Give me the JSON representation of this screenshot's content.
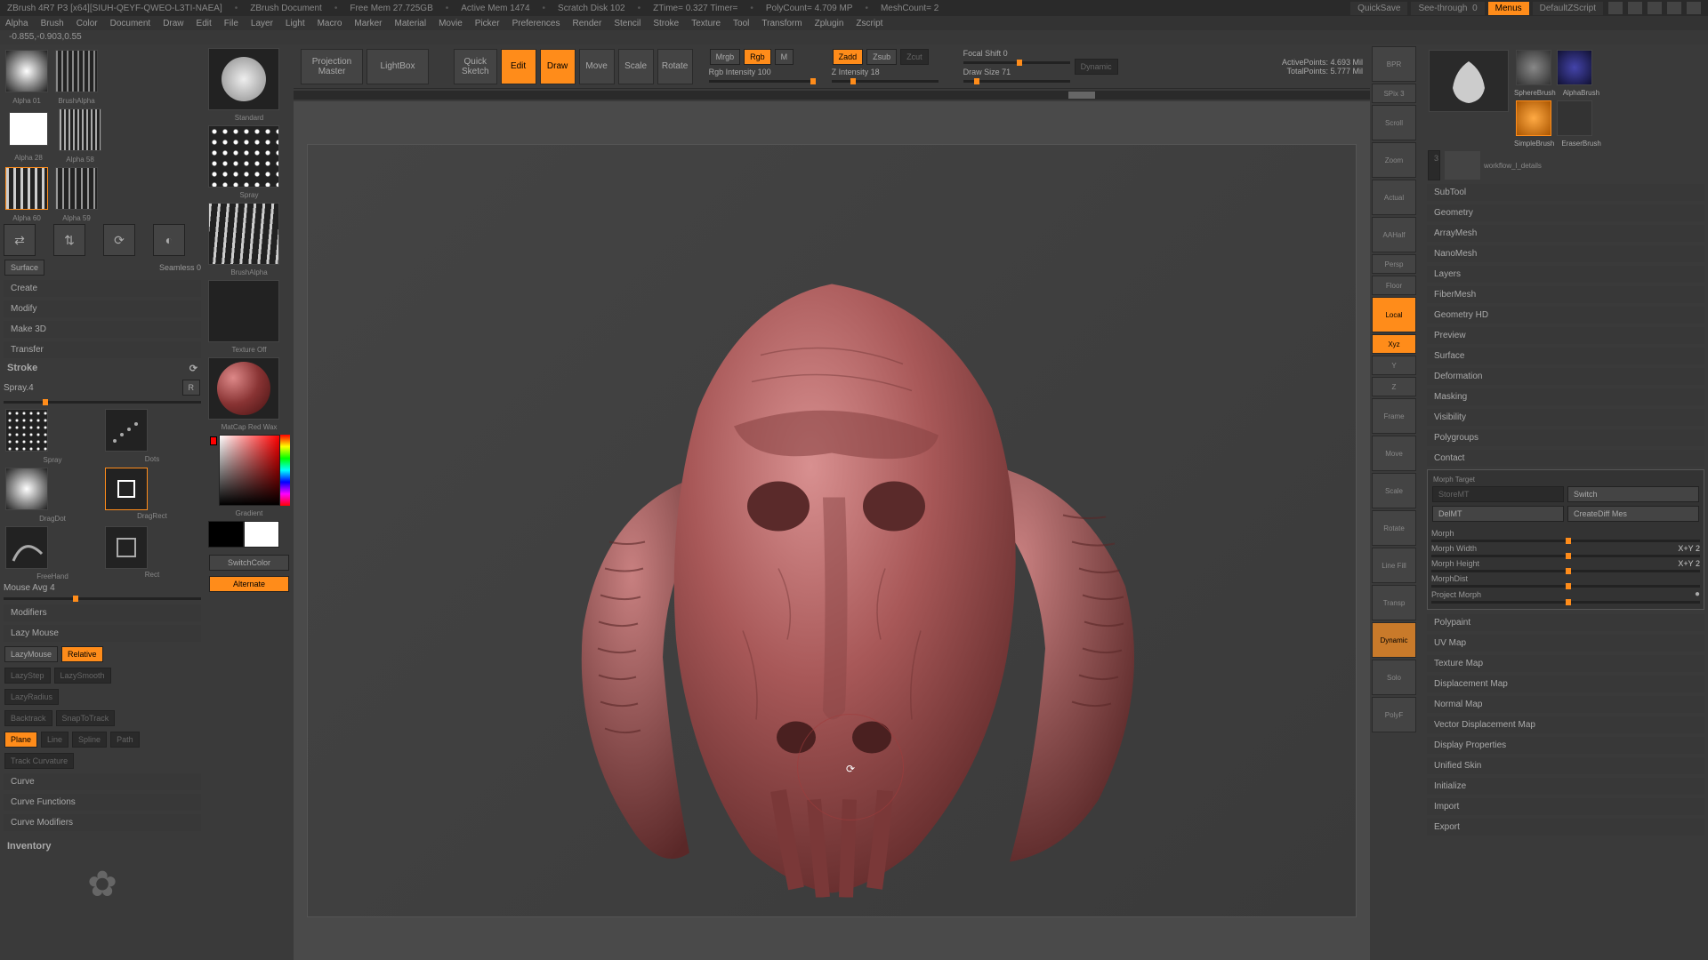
{
  "titlebar": {
    "app": "ZBrush 4R7 P3 [x64][SIUH-QEYF-QWEO-L3TI-NAEA]",
    "doc": "ZBrush Document",
    "freemem": "Free Mem 27.725GB",
    "activemem": "Active Mem 1474",
    "scratch": "Scratch Disk 102",
    "ztime": "ZTime= 0.327 Timer=",
    "polycount": "PolyCount= 4.709 MP",
    "meshcount": "MeshCount= 2",
    "quicksave": "QuickSave",
    "seethrough": "See-through",
    "seethroughval": "0",
    "menus": "Menus",
    "defaultscript": "DefaultZScript"
  },
  "menubar": [
    "Alpha",
    "Brush",
    "Color",
    "Document",
    "Draw",
    "Edit",
    "File",
    "Layer",
    "Light",
    "Macro",
    "Marker",
    "Material",
    "Movie",
    "Picker",
    "Preferences",
    "Render",
    "Stencil",
    "Stroke",
    "Texture",
    "Tool",
    "Transform",
    "Zplugin",
    "Zscript"
  ],
  "status": "-0.855,-0.903,0.55",
  "toolbar": {
    "projection": "Projection\nMaster",
    "lightbox": "LightBox",
    "quicksketch": "Quick\nSketch",
    "edit": "Edit",
    "draw": "Draw",
    "move": "Move",
    "scale": "Scale",
    "rotate": "Rotate",
    "mrgb": "Mrgb",
    "rgb": "Rgb",
    "m": "M",
    "rgbintensity": "Rgb Intensity 100",
    "zadd": "Zadd",
    "zsub": "Zsub",
    "zcut": "Zcut",
    "zintensity": "Z Intensity 18",
    "focalshift": "Focal Shift 0",
    "drawsize": "Draw Size 71",
    "dynamic": "Dynamic",
    "activepoints": "ActivePoints: 4.693 Mil",
    "totalpoints": "TotalPoints: 5.777 Mil"
  },
  "left": {
    "alpha": {
      "a01": "Alpha 01",
      "a28": "Alpha 28",
      "a58": "Alpha 58",
      "a60": "Alpha 60",
      "brushalpha": "BrushAlpha",
      "a59": "Alpha 59"
    },
    "flip": [
      "Flip H",
      "Flip V",
      "Rotate",
      "Invers"
    ],
    "surface": "Surface",
    "seamless": "Seamless 0",
    "create": "Create",
    "modify": "Modify",
    "make3d": "Make 3D",
    "transfer": "Transfer",
    "stroke": "Stroke",
    "spray4": "Spray.4",
    "r": "R",
    "strokes": {
      "spray": "Spray",
      "dots": "Dots",
      "dragdot": "DragDot",
      "spray2": "Spray",
      "freehand": "FreeHand",
      "rect": "Rect",
      "dragrect": "DragRect"
    },
    "mouseavg": "Mouse Avg 4",
    "modifiers": "Modifiers",
    "lazymouse": "Lazy Mouse",
    "lazymouse2": "LazyMouse",
    "relative": "Relative",
    "lazystep": "LazyStep",
    "lazysmooth": "LazySmooth",
    "lazyradius": "LazyRadius",
    "backtrack": "Backtrack",
    "snaptotrack": "SnapToTrack",
    "plane": "Plane",
    "line": "Line",
    "spline": "Spline",
    "path": "Path",
    "trackcurv": "Track Curvature",
    "curve": "Curve",
    "curvefunc": "Curve Functions",
    "curvemod": "Curve Modifiers",
    "inventory": "Inventory"
  },
  "midleft": {
    "standard": "Standard",
    "spray": "Spray",
    "brushalpha": "BrushAlpha",
    "textureoff": "Texture Off",
    "material": "MatCap Red Wax",
    "gradient": "Gradient",
    "switchcolor": "SwitchColor",
    "alternate": "Alternate"
  },
  "rightnav": [
    "BPR",
    "SPix 3",
    "Scroll",
    "Zoom",
    "Actual",
    "AAHalf",
    "Persp",
    "Floor",
    "Local",
    "Xyz",
    "Y",
    "Z",
    "Frame",
    "Move",
    "Scale",
    "Rotate",
    "Line Fill",
    "Transp",
    "Dynamic",
    "Solo",
    "PolyF"
  ],
  "tools": {
    "spherebrush": "SphereBrush",
    "alphabrush": "AlphaBrush",
    "simplebrush": "SimpleBrush",
    "eraserbrush": "EraserBrush",
    "workflow1": "workflow_l_details",
    "workflow2": "workflow_l_details"
  },
  "rightpanel": {
    "sections": [
      "SubTool",
      "Geometry",
      "ArrayMesh",
      "NanoMesh",
      "Layers",
      "FiberMesh",
      "Geometry HD",
      "Preview",
      "Surface",
      "Deformation",
      "Masking",
      "Visibility",
      "Polygroups",
      "Contact"
    ],
    "morphtarget": "Morph Target",
    "storemt": "StoreMT",
    "switch": "Switch",
    "delmt": "DelMT",
    "creatediff": "CreateDiff Mes",
    "morph": "Morph",
    "morphwidth": "Morph Width",
    "morphheight": "Morph Height",
    "morphdist": "MorphDist",
    "projectmorph": "Project Morph",
    "mwval": "X+Y 2",
    "mhval": "X+Y 2",
    "sections2": [
      "Polypaint",
      "UV Map",
      "Texture Map",
      "Displacement Map",
      "Normal Map",
      "Vector Displacement Map",
      "Display Properties",
      "Unified Skin",
      "Initialize",
      "Import",
      "Export"
    ]
  }
}
